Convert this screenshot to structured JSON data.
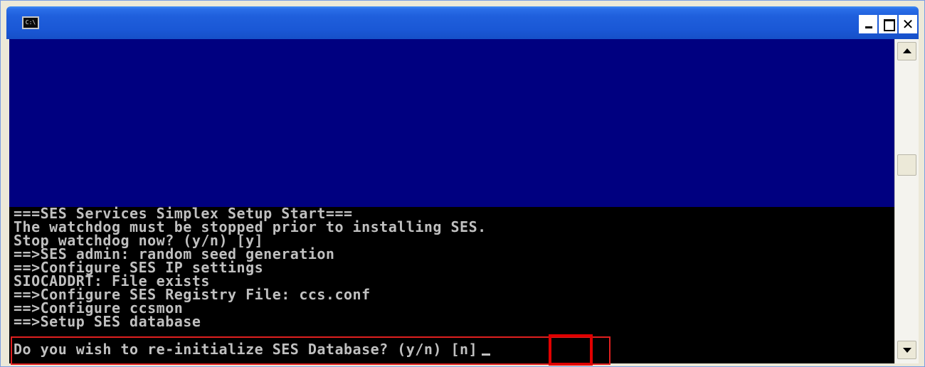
{
  "window": {
    "icon_label": "C:\\",
    "title": ""
  },
  "controls": {
    "minimize_icon": "minimize-icon",
    "maximize_icon": "maximize-icon",
    "close_glyph": "✕"
  },
  "console": {
    "background_colors": {
      "upper": "#000080",
      "lower": "#000000",
      "text": "#c0c0c0"
    },
    "lines": [
      "===SES Services Simplex Setup Start===",
      "The watchdog must be stopped prior to installing SES.",
      "Stop watchdog now? (y/n) [y]",
      "==>SES admin: random seed generation",
      "==>Configure SES IP settings",
      "SIOCADDRT: File exists",
      "==>Configure SES Registry File: ccs.conf",
      "==>Configure ccsmon",
      "==>Setup SES database"
    ],
    "prompt": {
      "question": "Do you wish to re-initialize SES Database? (y/n) ",
      "default_answer": "[n]"
    }
  },
  "annotations": {
    "highlight_color": "#e00000"
  },
  "scrollbar": {
    "up_icon": "scroll-up-arrow-icon",
    "down_icon": "scroll-down-arrow-icon"
  }
}
